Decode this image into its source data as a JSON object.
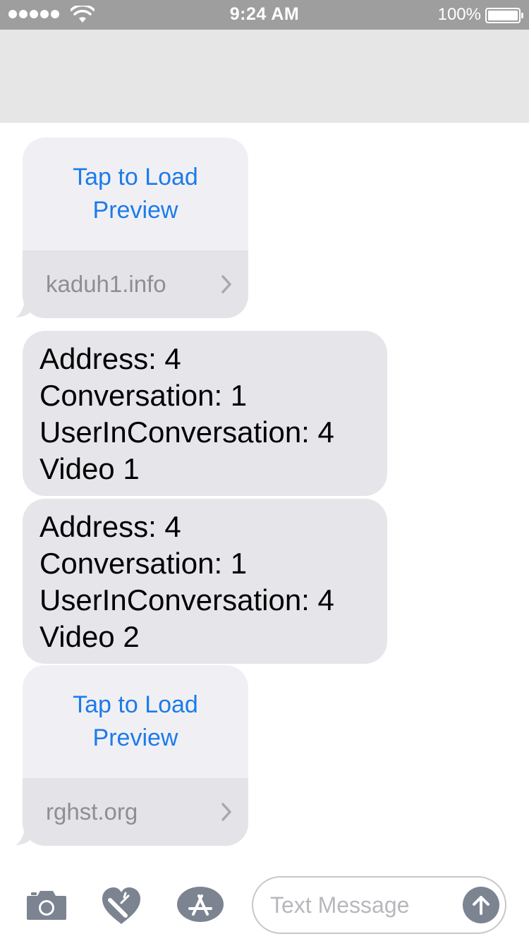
{
  "status_bar": {
    "time": "9:24 AM",
    "battery_percent": "100%",
    "signal_bars": 5,
    "battery_level": 1.0
  },
  "messages": [
    {
      "type": "link",
      "preview_text": "Tap to Load Preview",
      "domain": "kaduh1.info"
    },
    {
      "type": "text",
      "lines": [
        "Address: 4",
        "Conversation: 1",
        "UserInConversation: 4",
        "Video 1"
      ]
    },
    {
      "type": "text",
      "lines": [
        "Address: 4",
        "Conversation: 1",
        "UserInConversation: 4",
        "Video 2"
      ]
    },
    {
      "type": "link",
      "preview_text": "Tap to Load Preview",
      "domain": "rghst.org"
    }
  ],
  "input_bar": {
    "placeholder": "Text Message",
    "icons": [
      "camera-icon",
      "digital-touch-icon",
      "app-store-icon",
      "send-icon"
    ]
  },
  "colors": {
    "link_blue": "#1d7bea",
    "received_bubble": "#e5e5ea",
    "link_bubble": "#f0f0f4",
    "status_bar": "#9e9e9e",
    "icon_gray": "#7c8391"
  }
}
